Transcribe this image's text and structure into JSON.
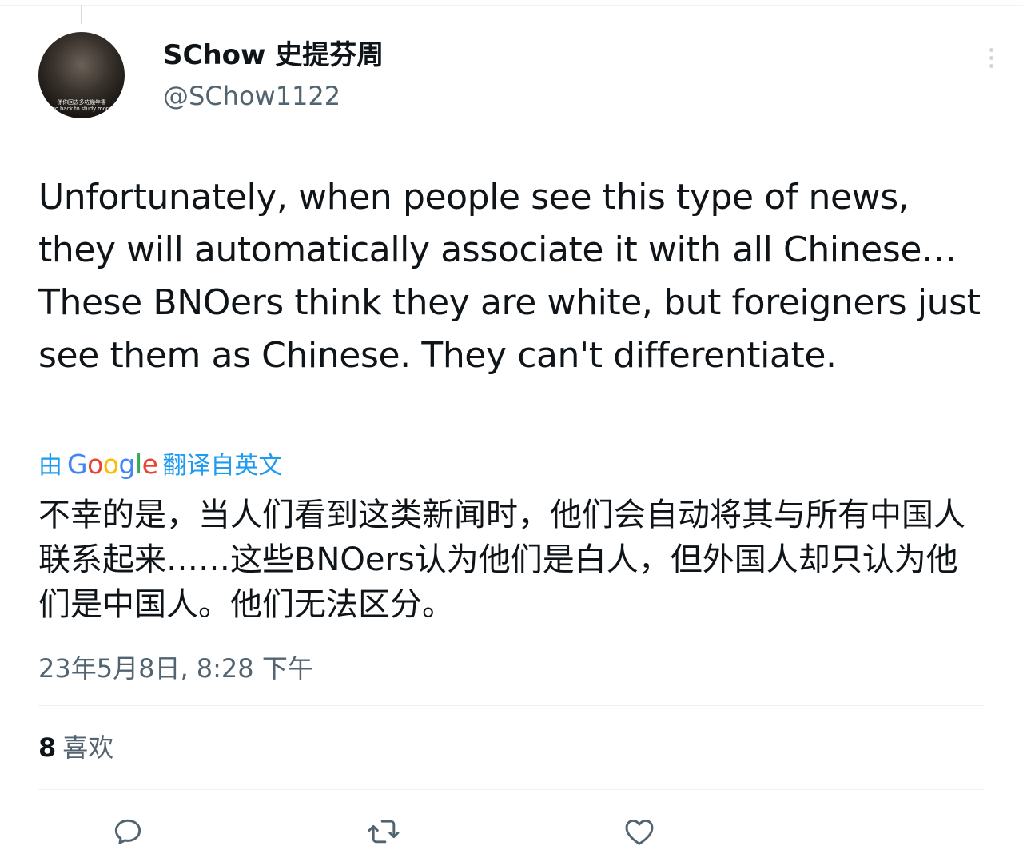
{
  "tweet": {
    "author": {
      "display_name": "SChow 史提芬周",
      "handle": "@SChow1122",
      "avatar_caption_line1": "係你回去多咗幾年書",
      "avatar_caption_line2": "go back to study more"
    },
    "text": "Unfortunately, when people see this type of news, they will automatically associate it with all Chinese…These BNOers think they are white, but foreigners just see them as Chinese. They can't differentiate.",
    "translation_notice": {
      "prefix": "由",
      "provider": "Google",
      "action": "翻译自英文"
    },
    "translated_text": "不幸的是，当人们看到这类新闻时，他们会自动将其与所有中国人联系起来……这些BNOers认为他们是白人，但外国人却只认为他们是中国人。他们无法区分。",
    "timestamp": "23年5月8日, 8:28 下午",
    "likes": {
      "count": "8",
      "label": "喜欢"
    }
  },
  "icons": {
    "more": "more-vertical-icon",
    "reply": "reply-icon",
    "retweet": "retweet-icon",
    "like": "heart-icon"
  },
  "colors": {
    "text": "#0f1419",
    "secondary": "#536471",
    "link": "#1d9bf0",
    "divider": "#eff3f4"
  }
}
